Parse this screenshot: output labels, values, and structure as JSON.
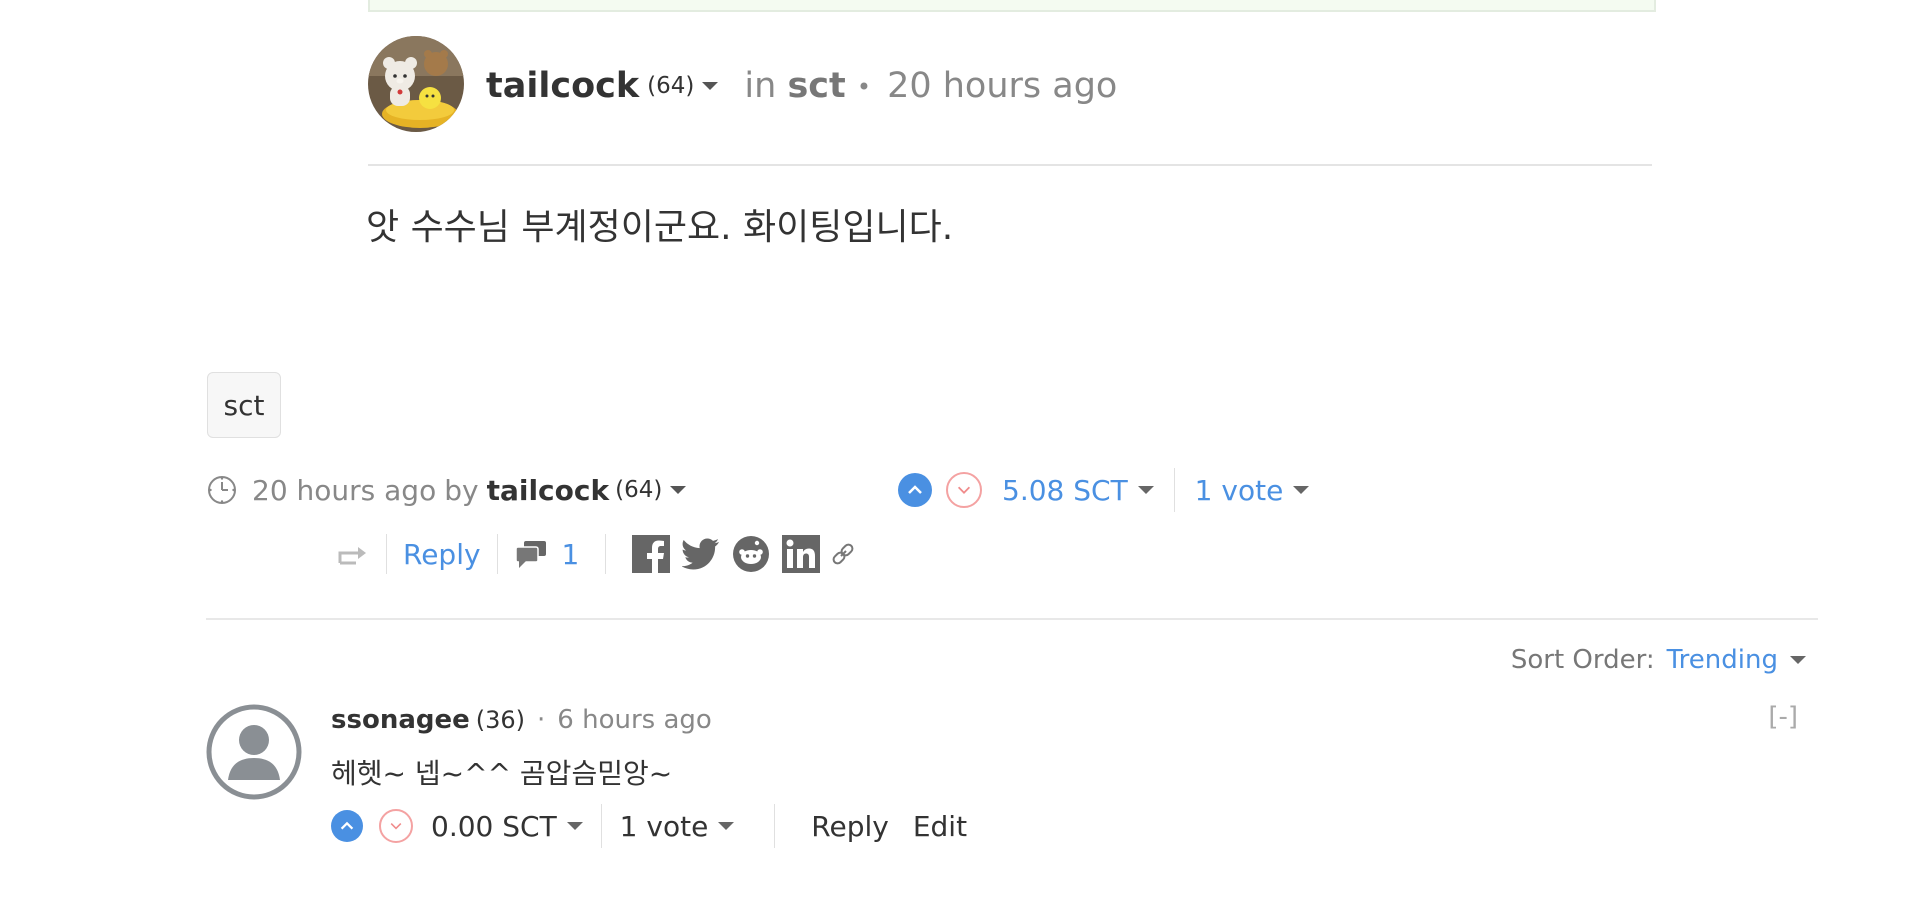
{
  "post": {
    "author": "tailcock",
    "reputation": "(64)",
    "in_label": "in",
    "community": "sct",
    "bullet": "•",
    "time": "20 hours ago",
    "body": "앗 수수님 부계정이군요. 화이팅입니다."
  },
  "tag": "sct",
  "footer": {
    "time": "20 hours ago",
    "by_label": "by",
    "author": "tailcock",
    "reputation": "(64)",
    "payout": "5.08 SCT",
    "votes": "1 vote",
    "reply_label": "Reply",
    "comment_count": "1"
  },
  "sort": {
    "label": "Sort Order:",
    "value": "Trending"
  },
  "comment": {
    "author": "ssonagee",
    "reputation": "(36)",
    "separator": "·",
    "time": "6 hours ago",
    "collapse": "[-]",
    "body": "헤헷~ 넵~^^ 곰압슴믿앙~",
    "payout": "0.00 SCT",
    "votes": "1 vote",
    "reply_label": "Reply",
    "edit_label": "Edit"
  },
  "colors": {
    "accent": "#4a90e2",
    "downvote": "#f4a2a2",
    "muted": "#888888"
  },
  "icons": [
    "clock-icon",
    "upvote-icon",
    "downvote-icon",
    "resteem-icon",
    "comments-icon",
    "facebook-icon",
    "twitter-icon",
    "reddit-icon",
    "linkedin-icon",
    "link-icon",
    "avatar-placeholder-icon"
  ]
}
